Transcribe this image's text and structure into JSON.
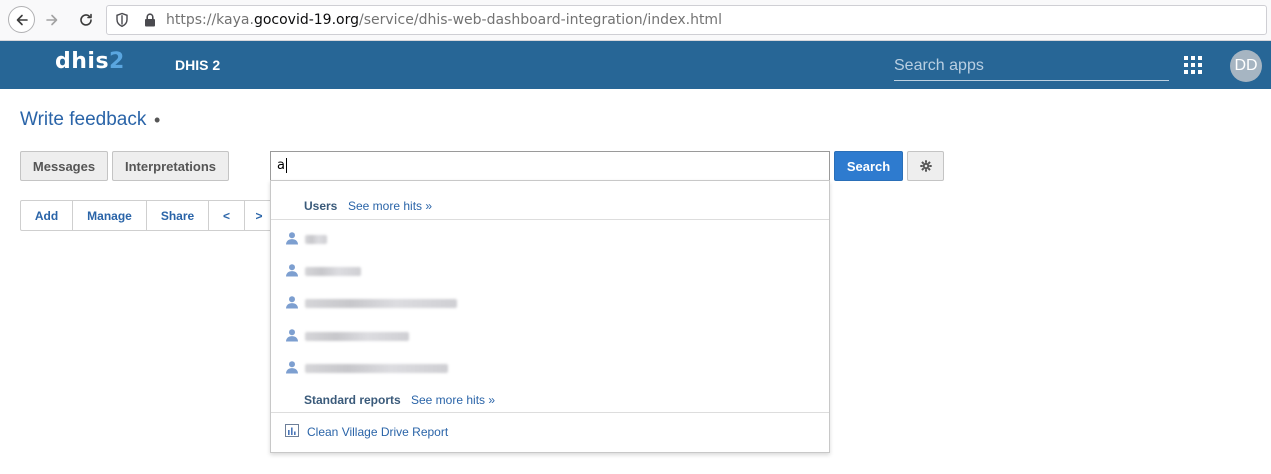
{
  "browser": {
    "url_prefix": "https://kaya.",
    "url_domain": "gocovid-19.org",
    "url_path": "/service/dhis-web-dashboard-integration/index.html"
  },
  "header": {
    "logo_main": "dhis",
    "logo_accent": "2",
    "app_title": "DHIS 2",
    "search_placeholder": "Search apps",
    "avatar_initials": "DD"
  },
  "page": {
    "title": "Write feedback",
    "title_suffix": "•"
  },
  "toolbar": {
    "messages_label": "Messages",
    "interpretations_label": "Interpretations",
    "search_value": "a",
    "search_button_label": "Search"
  },
  "dashboard_controls": {
    "add_label": "Add",
    "manage_label": "Manage",
    "share_label": "Share",
    "prev_label": "<",
    "next_label": ">"
  },
  "search_results": {
    "users_heading": "Users",
    "users_see_more": "See more hits »",
    "reports_heading": "Standard reports",
    "reports_see_more": "See more hits »",
    "reports": [
      {
        "label": "Clean Village Drive Report"
      }
    ]
  }
}
